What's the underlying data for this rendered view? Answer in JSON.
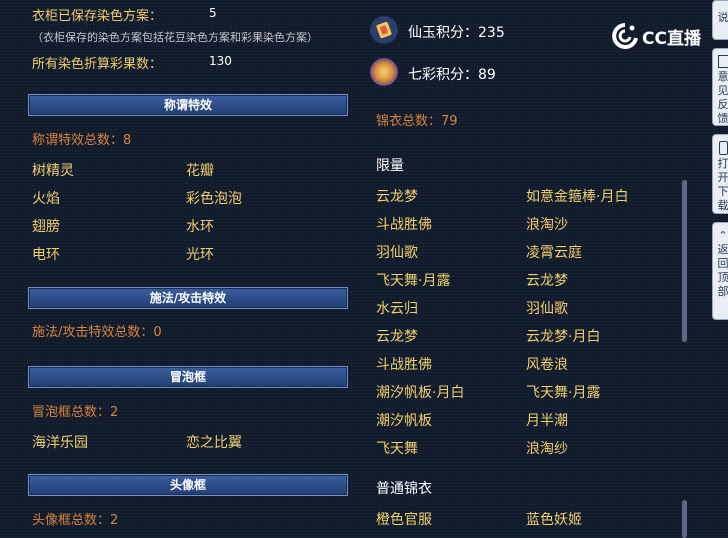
{
  "left": {
    "saved_label": "衣柜已保存染色方案：",
    "saved_value": "5",
    "saved_note": "（衣柜保存的染色方案包括花豆染色方案和彩果染色方案）",
    "caiguo_label": "所有染色折算彩果数：",
    "caiguo_value": "130",
    "sections": [
      {
        "title": "称谓特效",
        "count": "称谓特效总数：8",
        "items": [
          "树精灵",
          "花瓣",
          "火焰",
          "彩色泡泡",
          "翅膀",
          "水环",
          "电环",
          "光环"
        ]
      },
      {
        "title": "施法/攻击特效",
        "count": "施法/攻击特效总数：0",
        "items": []
      },
      {
        "title": "冒泡框",
        "count": "冒泡框总数：2",
        "items": [
          "海洋乐园",
          "恋之比翼"
        ]
      },
      {
        "title": "头像框",
        "count": "头像框总数：2",
        "items": []
      }
    ]
  },
  "right": {
    "xianyu_label": "仙玉积分：235",
    "qicai_label": "七彩积分：89",
    "jinyi_total": "锦衣总数：79",
    "limited_title": "限量",
    "limited_items": [
      [
        "云龙梦",
        "如意金箍棒·月白"
      ],
      [
        "斗战胜佛",
        "浪淘沙"
      ],
      [
        "羽仙歌",
        "凌霄云庭"
      ],
      [
        "飞天舞·月露",
        "云龙梦"
      ],
      [
        "水云归",
        "羽仙歌"
      ],
      [
        "云龙梦",
        "云龙梦·月白"
      ],
      [
        "斗战胜佛",
        "风卷浪"
      ],
      [
        "潮汐帆板·月白",
        "飞天舞·月露"
      ],
      [
        "潮汐帆板",
        "月半潮"
      ],
      [
        "飞天舞",
        "浪淘纱"
      ]
    ],
    "normal_title": "普通锦衣",
    "normal_items": [
      [
        "橙色官服",
        "蓝色妖姬"
      ]
    ]
  },
  "watermark": "CC直播",
  "side_tabs": [
    "说",
    "意见反馈",
    "打开下载",
    "返回顶部"
  ]
}
